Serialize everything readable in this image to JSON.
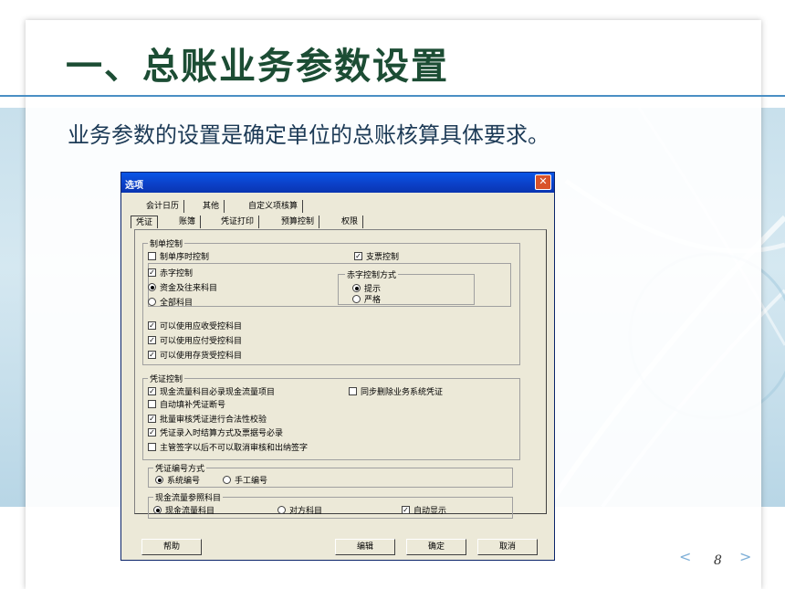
{
  "slide": {
    "title": "一、总账业务参数设置",
    "subtitle": "业务参数的设置是确定单位的总账核算具体要求。",
    "page_number": "8",
    "nav_prev": "<",
    "nav_next": ">"
  },
  "dialog": {
    "title": "选项",
    "close_symbol": "✕",
    "tabs_row1": [
      "会计日历",
      "其他",
      "自定义项核算"
    ],
    "tabs_row2": [
      "凭证",
      "账簿",
      "凭证打印",
      "预算控制",
      "权限"
    ],
    "active_tab": "凭证",
    "groups": {
      "zhidan": {
        "label": "制单控制",
        "items": {
          "zhidan_xushi": {
            "label": "制单序时控制",
            "checked": false
          },
          "zhipiao": {
            "label": "支票控制",
            "checked": true
          },
          "chizi": {
            "label": "赤字控制",
            "checked": true
          },
          "zijin": {
            "label": "资金及往来科目",
            "selected": true
          },
          "quanbu": {
            "label": "全部科目",
            "selected": false
          },
          "yingshou": {
            "label": "可以使用应收受控科目",
            "checked": true
          },
          "yingfu": {
            "label": "可以使用应付受控科目",
            "checked": true
          },
          "cunhuo": {
            "label": "可以使用存货受控科目",
            "checked": true
          }
        },
        "chizi_mode": {
          "label": "赤字控制方式",
          "tishi": {
            "label": "提示",
            "selected": true
          },
          "yange": {
            "label": "严格",
            "selected": false
          }
        }
      },
      "pingzheng": {
        "label": "凭证控制",
        "items": {
          "xianjin": {
            "label": "现金流量科目必录现金流量项目",
            "checked": true
          },
          "tongbu": {
            "label": "同步删除业务系统凭证",
            "checked": false
          },
          "zidong": {
            "label": "自动填补凭证断号",
            "checked": false
          },
          "piliang": {
            "label": "批量审核凭证进行合法性校验",
            "checked": true
          },
          "jiesuan": {
            "label": "凭证录入时结算方式及票据号必录",
            "checked": true
          },
          "zhuguan": {
            "label": "主管签字以后不可以取消审核和出纳签字",
            "checked": false
          }
        }
      },
      "bianhao": {
        "label": "凭证编号方式",
        "xitong": {
          "label": "系统编号",
          "selected": true
        },
        "shougong": {
          "label": "手工编号",
          "selected": false
        }
      },
      "xianjinliu": {
        "label": "现金流量参照科目",
        "xianjin_km": {
          "label": "现金流量科目",
          "selected": true
        },
        "duifang": {
          "label": "对方科目",
          "selected": false
        },
        "zidong_xianshi": {
          "label": "自动显示",
          "checked": true
        }
      }
    },
    "buttons": {
      "help": "帮助",
      "edit": "编辑",
      "ok": "确定",
      "cancel": "取消"
    },
    "check_mark": "✓"
  }
}
